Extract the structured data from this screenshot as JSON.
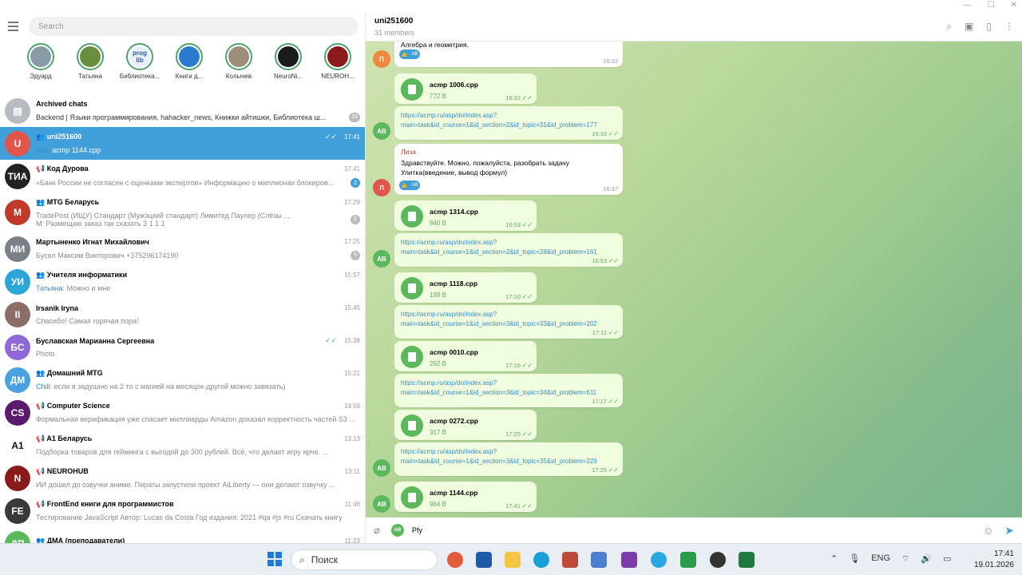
{
  "left": {
    "search_placeholder": "Search",
    "stories": [
      {
        "name": "Эдуард",
        "color": "#8a9ba8",
        "initials": ""
      },
      {
        "name": "Татьяна",
        "color": "#6b8e3e",
        "initials": ""
      },
      {
        "name": "Библиотека...",
        "color": "#e8f0fa",
        "initials": "prog lib"
      },
      {
        "name": "Книги д...",
        "color": "#2a7bd0",
        "initials": ""
      },
      {
        "name": "Колычев",
        "color": "#9b8f7a",
        "initials": ""
      },
      {
        "name": "NeuroNi...",
        "color": "#1b1b1b",
        "initials": ""
      },
      {
        "name": "NEUROH...",
        "color": "#8b1a1a",
        "initials": ""
      }
    ],
    "archived": {
      "title": "Archived chats",
      "preview": "Backend | Языки программирования, hahacker_news, Книжки айтишки, Библиотека ш...",
      "count": "28"
    },
    "chats": [
      {
        "initials": "U",
        "color": "#e0564b",
        "icon": "👥",
        "name": "uni251600",
        "time": "17:41",
        "sender": "You: ",
        "preview": "acmp 1144.cpp",
        "badge": "",
        "check": "✓✓",
        "active": true
      },
      {
        "initials": "ТИА",
        "color": "#222222",
        "icon": "📢",
        "name": "Код Дурова",
        "time": "17:41",
        "sender": "",
        "preview": "«Банк России не согласен с оценками экспертов» Информацию о миллионах блокиров...",
        "badge": "2",
        "check": ""
      },
      {
        "initials": "M",
        "color": "#c0392b",
        "icon": "👥",
        "name": "MTG Беларусь",
        "time": "17:29",
        "sender": "",
        "preview": "TradePost (ИЩУ)  Стандарт (Мужэцкий стандарт)  Лимитед  Паупер (Слёзы ...",
        "preview2": "M: Размещаю заказ так сказать 3 1 1 1",
        "badge": "5",
        "check": ""
      },
      {
        "initials": "МИ",
        "color": "#7a7f88",
        "icon": "",
        "name": "Мартыненко Игнат Михайлович",
        "time": "17:25",
        "sender": "",
        "preview": "Бусел Максим Викторович +375296174190",
        "badge": "5",
        "check": ""
      },
      {
        "initials": "УИ",
        "color": "#2aa6d8",
        "icon": "👥",
        "name": "Учителя информатики",
        "time": "15:57",
        "sender": "Татьяна: ",
        "preview": "Можно и мне",
        "badge": "",
        "check": ""
      },
      {
        "initials": "II",
        "color": "#8a6e67",
        "icon": "",
        "name": "Irsanik Iryna",
        "time": "15:45",
        "sender": "",
        "preview": "Спасибо! Самая горячая пора!",
        "badge": "",
        "check": ""
      },
      {
        "initials": "БС",
        "color": "#9068d8",
        "icon": "",
        "name": "Буславская Марианна Сергеевна",
        "time": "15:38",
        "sender": "",
        "preview": "Photo",
        "badge": "",
        "check": "✓✓"
      },
      {
        "initials": "ДМ",
        "color": "#4aa0e0",
        "icon": "👥",
        "name": "Домашний MTG",
        "time": "15:21",
        "sender": "Chill: ",
        "preview": "если я задушню на 2 то с магией на месяцок-другой можно завязать)",
        "badge": "",
        "check": ""
      },
      {
        "initials": "CS",
        "color": "#5a1b6e",
        "icon": "📢",
        "name": "Computer Science",
        "time": "14:59",
        "sender": "",
        "preview": "Формальная верификация уже спасает миллиарды  Amazon доказал корректность частей S3 и ...",
        "badge": "",
        "check": ""
      },
      {
        "initials": "A1",
        "color": "#ffffff",
        "icon": "📢",
        "name": "A1 Беларусь",
        "time": "13:13",
        "sender": "",
        "preview": "Подборка товаров для гейминга с выгодой до 300 рублей. Всё, что делает игру ярче. ...",
        "badge": "",
        "check": ""
      },
      {
        "initials": "N",
        "color": "#8b1a1a",
        "icon": "📢",
        "name": "NEUROHUB",
        "time": "13:11",
        "sender": "",
        "preview": "ИИ дошел до озвучки аниме. Пираты запустили проект AiLiberty — они делают озвучку ...",
        "badge": "",
        "check": ""
      },
      {
        "initials": "FE",
        "color": "#3a3a3a",
        "icon": "📢",
        "name": "FrontEnd книги для программистов",
        "time": "11:46",
        "sender": "",
        "preview": "Тестирование JavaScript  Автор: Lucas da Costa Год издания: 2021  #qa #js #ru  Скачать книгу",
        "badge": "",
        "check": ""
      },
      {
        "initials": "ДП",
        "color": "#5cb85c",
        "icon": "👥",
        "name": "ДМА (преподаватели)",
        "time": "11:23",
        "sender": "",
        "preview": "",
        "badge": "",
        "check": ""
      }
    ]
  },
  "header": {
    "title": "uni251600",
    "subtitle": "31 members"
  },
  "messages": {
    "top_text": "Алгебра и геометрия.",
    "top_time": "16:32",
    "reaction_label": "AB",
    "files": [
      {
        "name": "acmp 1006.cpp",
        "size": "772 B",
        "time": "16:32"
      },
      {
        "name": "acmp 1314.cpp",
        "size": "940 B",
        "time": "16:53"
      },
      {
        "name": "acmp 1118.cpp",
        "size": "199 B",
        "time": "17:10"
      },
      {
        "name": "acmp 0010.cpp",
        "size": "262 B",
        "time": "17:16"
      },
      {
        "name": "acmp 0272.cpp",
        "size": "317 B",
        "time": "17:25"
      },
      {
        "name": "acmp 1144.cpp",
        "size": "964 B",
        "time": "17:41"
      }
    ],
    "links": [
      {
        "text": "https://acmp.ru/asp/do/index.asp?\nmain=task&id_course=1&id_section=2&id_topic=31&id_problem=177",
        "time": "16:33"
      },
      {
        "text": "https://acmp.ru/asp/do/index.asp?\nmain=task&id_course=1&id_section=2&id_topic=28&id_problem=161",
        "time": "16:53"
      },
      {
        "text": "https://acmp.ru/asp/do/index.asp?\nmain=task&id_course=1&id_section=3&id_topic=33&id_problem=202",
        "time": "17:11"
      },
      {
        "text": "https://acmp.ru/asp/do/index.asp?\nmain=task&id_course=1&id_section=3&id_topic=34&id_problem=611",
        "time": "17:17"
      },
      {
        "text": "https://acmp.ru/asp/do/index.asp?\nmain=task&id_course=1&id_section=3&id_topic=35&id_problem=229",
        "time": "17:25"
      }
    ],
    "liza": {
      "author": "Лиза",
      "text1": "Здравствуйте. Можно, пожалуйста, разобрать задачу",
      "text2": "Улитка(введение, вывод формул)",
      "time": "16:37"
    },
    "avatars": {
      "p": "П",
      "ab": "AB",
      "l": "Л"
    }
  },
  "input": {
    "avatar": "AB",
    "value": "Рfу"
  },
  "taskbar": {
    "search": "Поиск",
    "lang": "ENG",
    "time": "17:41",
    "date": "19.01.2026"
  }
}
